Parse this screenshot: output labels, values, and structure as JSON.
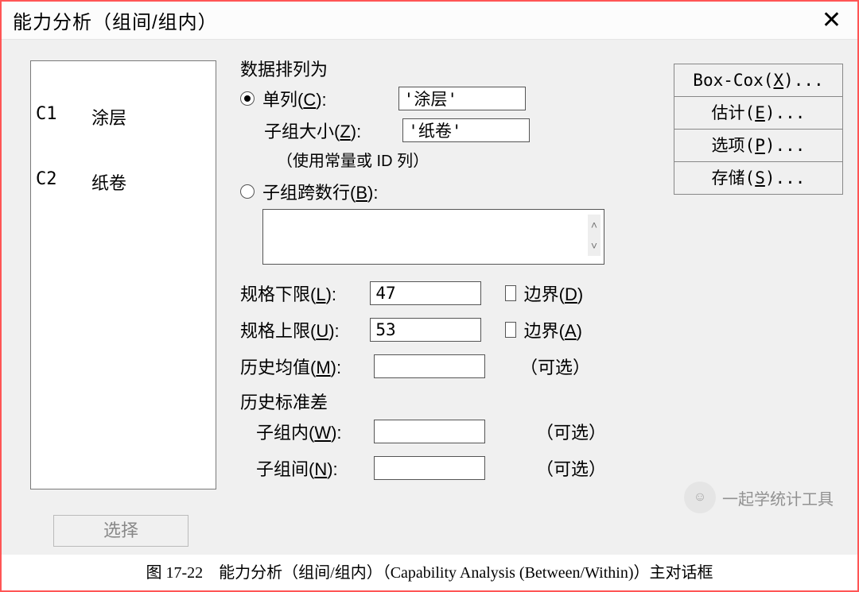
{
  "titlebar": {
    "title": "能力分析（组间/组内）"
  },
  "varlist": {
    "rows": [
      {
        "code": "C1",
        "name": "涂层"
      },
      {
        "code": "C2",
        "name": "纸卷"
      }
    ]
  },
  "select_btn": "选择",
  "arrangement": {
    "header": "数据排列为",
    "single_col_label_pre": "单列(",
    "single_col_key": "C",
    "single_col_label_post": "):",
    "single_col_value": "'涂层'",
    "subgroup_size_label_pre": "子组大小(",
    "subgroup_size_key": "Z",
    "subgroup_size_label_post": "):",
    "subgroup_size_value": "'纸卷'",
    "subgroup_size_note": "（使用常量或 ID 列）",
    "multi_row_label_pre": "子组跨数行(",
    "multi_row_key": "B",
    "multi_row_label_post": "):"
  },
  "specs": {
    "lower_label_pre": "规格下限(",
    "lower_key": "L",
    "lower_label_post": "):",
    "lower_value": "47",
    "lower_bound_pre": "边界(",
    "lower_bound_key": "D",
    "lower_bound_post": ")",
    "upper_label_pre": "规格上限(",
    "upper_key": "U",
    "upper_label_post": "):",
    "upper_value": "53",
    "upper_bound_pre": "边界(",
    "upper_bound_key": "A",
    "upper_bound_post": ")",
    "hist_mean_label_pre": "历史均值(",
    "hist_mean_key": "M",
    "hist_mean_label_post": "):",
    "hist_mean_value": "",
    "hist_mean_opt": "（可选）",
    "hist_sd_header": "历史标准差",
    "within_label_pre": "子组内(",
    "within_key": "W",
    "within_label_post": "):",
    "within_value": "",
    "within_opt": "（可选）",
    "between_label_pre": "子组间(",
    "between_key": "N",
    "between_label_post": "):",
    "between_value": "",
    "between_opt": "（可选）"
  },
  "buttons": {
    "boxcox_pre": "Box-Cox(",
    "boxcox_key": "X",
    "boxcox_post": ")...",
    "estimate_pre": "估计(",
    "estimate_key": "E",
    "estimate_post": ")...",
    "options_pre": "选项(",
    "options_key": "P",
    "options_post": ")...",
    "storage_pre": "存储(",
    "storage_key": "S",
    "storage_post": ")..."
  },
  "caption": "图 17-22　能力分析（组间/组内）（Capability Analysis (Between/Within)）主对话框",
  "watermark": "一起学统计工具"
}
